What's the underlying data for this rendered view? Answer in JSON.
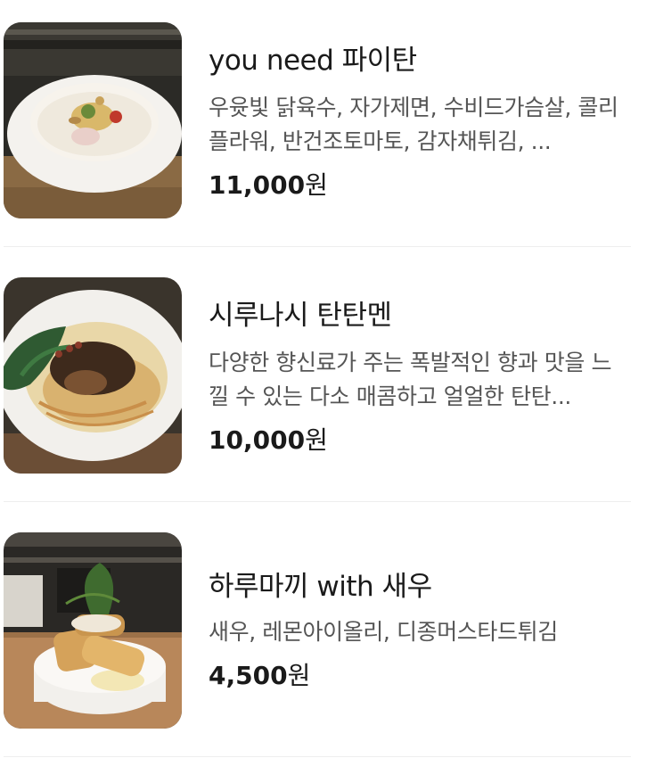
{
  "menu": {
    "items": [
      {
        "name": "you need 파이탄",
        "description": "우윳빛 닭육수, 자가제면, 수비드가슴살, 콜리플라워, 반건조토마토, 감자채튀김, ...",
        "price_number": "11,000",
        "price_unit": "원",
        "image": "paitan-ramen-photo"
      },
      {
        "name": "시루나시 탄탄멘",
        "description": "다양한 향신료가 주는 폭발적인 향과 맛을 느낄 수 있는 다소 매콤하고 얼얼한 탄탄...",
        "price_number": "10,000",
        "price_unit": "원",
        "image": "tantanmen-photo"
      },
      {
        "name": "하루마끼 with 새우",
        "description": "새우, 레몬아이올리, 디종머스타드튀김",
        "price_number": "4,500",
        "price_unit": "원",
        "image": "harumaki-shrimp-photo"
      }
    ]
  }
}
